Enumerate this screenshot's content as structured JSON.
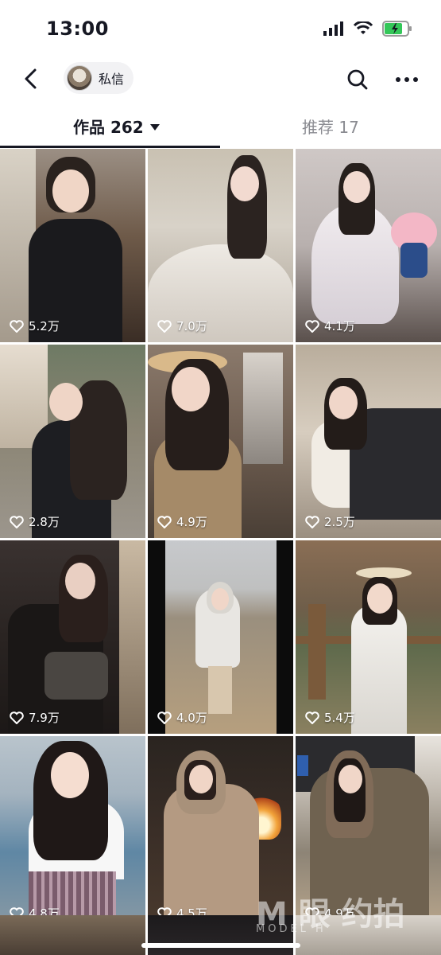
{
  "status": {
    "time": "13:00"
  },
  "nav": {
    "dm_label": "私信"
  },
  "tabs": {
    "works_label": "作品 262",
    "recommend_label": "推荐 17"
  },
  "tiles": [
    {
      "likes": "5.2万"
    },
    {
      "likes": "7.0万"
    },
    {
      "likes": "4.1万"
    },
    {
      "likes": "2.8万"
    },
    {
      "likes": "4.9万"
    },
    {
      "likes": "2.5万"
    },
    {
      "likes": "7.9万"
    },
    {
      "likes": "4.0万"
    },
    {
      "likes": "5.4万"
    },
    {
      "likes": "4.8万"
    },
    {
      "likes": "4.5万"
    },
    {
      "likes": "4.9万"
    }
  ],
  "watermark": {
    "main": "M 眼 约拍",
    "sub": "MODEL  H"
  },
  "colors": {
    "text": "#161823",
    "secondary": "#8a8b91"
  }
}
